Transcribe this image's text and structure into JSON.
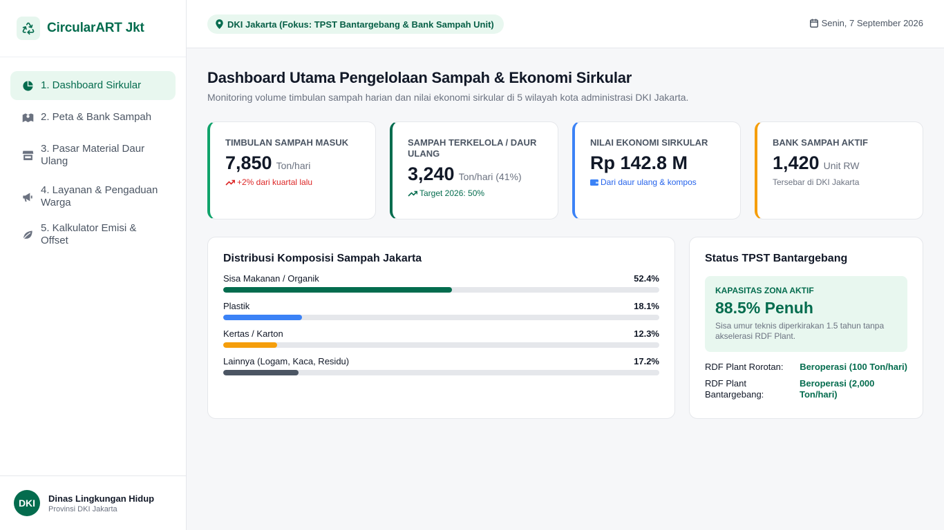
{
  "brand": {
    "name": "CircularART Jkt",
    "icon": "recycle-icon"
  },
  "nav": {
    "items": [
      {
        "label": "1. Dashboard Sirkular",
        "icon": "pie-chart-icon",
        "active": true
      },
      {
        "label": "2. Peta & Bank Sampah",
        "icon": "map-icon",
        "active": false
      },
      {
        "label": "3. Pasar Material Daur Ulang",
        "icon": "store-icon",
        "active": false
      },
      {
        "label": "4. Layanan & Pengaduan Warga",
        "icon": "megaphone-icon",
        "active": false
      },
      {
        "label": "5. Kalkulator Emisi & Offset",
        "icon": "leaf-icon",
        "active": false
      }
    ]
  },
  "user": {
    "avatar_text": "DKI",
    "name": "Dinas Lingkungan Hidup",
    "subtitle": "Provinsi DKI Jakarta"
  },
  "topbar": {
    "location": "DKI Jakarta (Fokus: TPST Bantargebang & Bank Sampah Unit)",
    "date": "Senin, 7 September 2026"
  },
  "page": {
    "title": "Dashboard Utama Pengelolaan Sampah & Ekonomi Sirkular",
    "subtitle": "Monitoring volume timbulan sampah harian dan nilai ekonomi sirkular di 5 wilayah kota administrasi DKI Jakarta."
  },
  "kpis": [
    {
      "label": "Timbulan Sampah Masuk",
      "value": "7,850",
      "unit": "Ton/hari",
      "note": "+2% dari kuartal lalu",
      "note_icon": "trend-up-icon",
      "accent": "#10a36b",
      "note_color": "#dc2626"
    },
    {
      "label": "Sampah Terkelola / Daur Ulang",
      "value": "3,240",
      "unit": "Ton/hari (41%)",
      "note": "Target 2026: 50%",
      "note_icon": "trend-up-icon",
      "accent": "#046c4e",
      "note_color": "#046c4e"
    },
    {
      "label": "Nilai Ekonomi Sirkular",
      "value": "Rp 142.8 M",
      "unit": "",
      "note": "Dari daur ulang & kompos",
      "note_icon": "wallet-icon",
      "accent": "#3b82f6",
      "note_color": "#2563eb"
    },
    {
      "label": "Bank Sampah Aktif",
      "value": "1,420",
      "unit": "Unit RW",
      "note": "Tersebar di DKI Jakarta",
      "note_icon": "",
      "accent": "#f59e0b",
      "note_color": "#6b7280"
    }
  ],
  "composition": {
    "title": "Distribusi Komposisi Sampah Jakarta",
    "items": [
      {
        "label": "Sisa Makanan / Organik",
        "pct_text": "52.4%",
        "pct": 52.4,
        "color": "#046c4e"
      },
      {
        "label": "Plastik",
        "pct_text": "18.1%",
        "pct": 18.1,
        "color": "#3b82f6"
      },
      {
        "label": "Kertas / Karton",
        "pct_text": "12.3%",
        "pct": 12.3,
        "color": "#f59e0b"
      },
      {
        "label": "Lainnya (Logam, Kaca, Residu)",
        "pct_text": "17.2%",
        "pct": 17.2,
        "color": "#4b5563"
      }
    ]
  },
  "tpst": {
    "title": "Status TPST Bantargebang",
    "capacity_label": "Kapasitas Zona Aktif",
    "capacity_value": "88.5% Penuh",
    "capacity_desc": "Sisa umur teknis diperkirakan 1.5 tahun tanpa akselerasi RDF Plant.",
    "plants": [
      {
        "name": "RDF Plant Rorotan:",
        "status": "Beroperasi (100 Ton/hari)"
      },
      {
        "name": "RDF Plant Bantargebang:",
        "status": "Beroperasi (2,000 Ton/hari)"
      }
    ]
  }
}
